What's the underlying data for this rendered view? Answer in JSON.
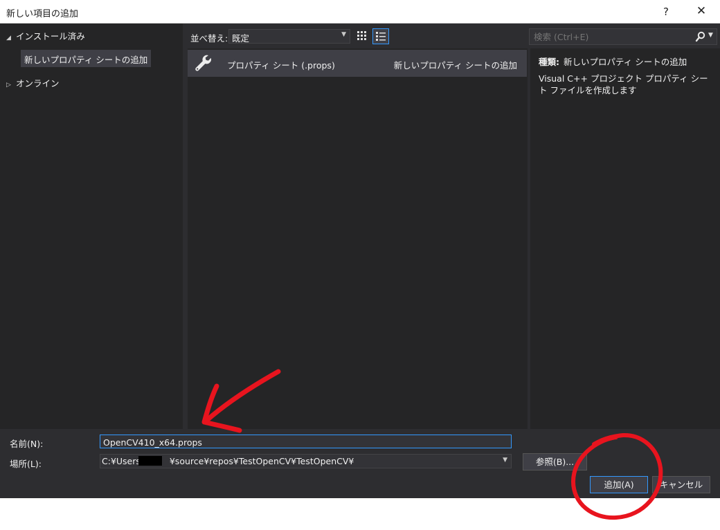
{
  "window": {
    "title": "新しい項目の追加",
    "help": "?",
    "close": "✕"
  },
  "tree": {
    "installed": "インストール済み",
    "installed_child": "新しいプロパティ シートの追加",
    "online": "オンライン"
  },
  "toolbar": {
    "sort_label": "並べ替え:",
    "sort_value": "既定",
    "search_placeholder": "検索 (Ctrl+E)"
  },
  "templates": [
    {
      "name": "プロパティ シート (.props)",
      "type": "新しいプロパティ シートの追加"
    }
  ],
  "details": {
    "type_label": "種類:",
    "type_value": "新しいプロパティ シートの追加",
    "description": "Visual C++ プロジェクト プロパティ シート ファイルを作成します"
  },
  "form": {
    "name_label": "名前(N):",
    "name_value": "OpenCV410_x64.props",
    "location_label": "場所(L):",
    "location_prefix": "C:¥Users¥",
    "location_suffix": "¥source¥repos¥TestOpenCV¥TestOpenCV¥",
    "browse_label": "参照(B)...",
    "add_label": "追加(A)",
    "cancel_label": "キャンセル"
  },
  "colors": {
    "background": "#2d2d30",
    "panel": "#252526",
    "selection": "#3f3f46",
    "accent": "#3399ff",
    "annotation": "#e8141e"
  },
  "icons": {
    "template": "wrench-icon",
    "search": "magnifier-icon",
    "grid_view": "grid-view-icon",
    "list_view": "list-view-icon"
  }
}
